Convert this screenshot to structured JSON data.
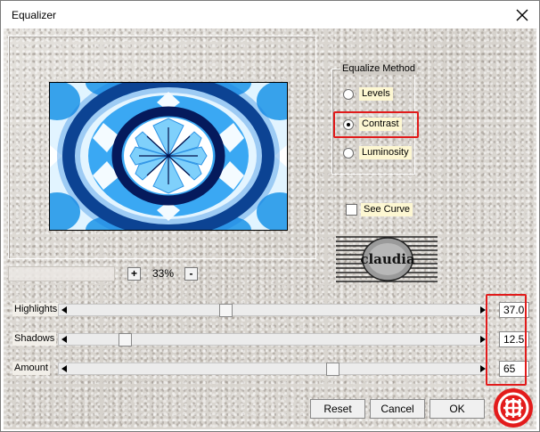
{
  "window": {
    "title": "Equalizer",
    "close_icon": "close-icon"
  },
  "zoom": {
    "plus_label": "+",
    "minus_label": "-",
    "value": "33%"
  },
  "equalize_method": {
    "legend": "Equalize Method",
    "options": [
      {
        "label": "Levels",
        "checked": false
      },
      {
        "label": "Contrast",
        "checked": true
      },
      {
        "label": "Luminosity",
        "checked": false
      }
    ]
  },
  "see_curve": {
    "label": "See Curve",
    "checked": false
  },
  "logo": {
    "text": "claudia"
  },
  "sliders": [
    {
      "label": "Highlights",
      "value": "37.0",
      "position": 0.38
    },
    {
      "label": "Shadows",
      "value": "12.5",
      "position": 0.125
    },
    {
      "label": "Amount",
      "value": "65",
      "position": 0.65
    }
  ],
  "buttons": {
    "reset": "Reset",
    "cancel": "Cancel",
    "ok": "OK"
  },
  "colors": {
    "highlight_red": "#e11b1b",
    "label_bg": "#fdf7d2"
  }
}
